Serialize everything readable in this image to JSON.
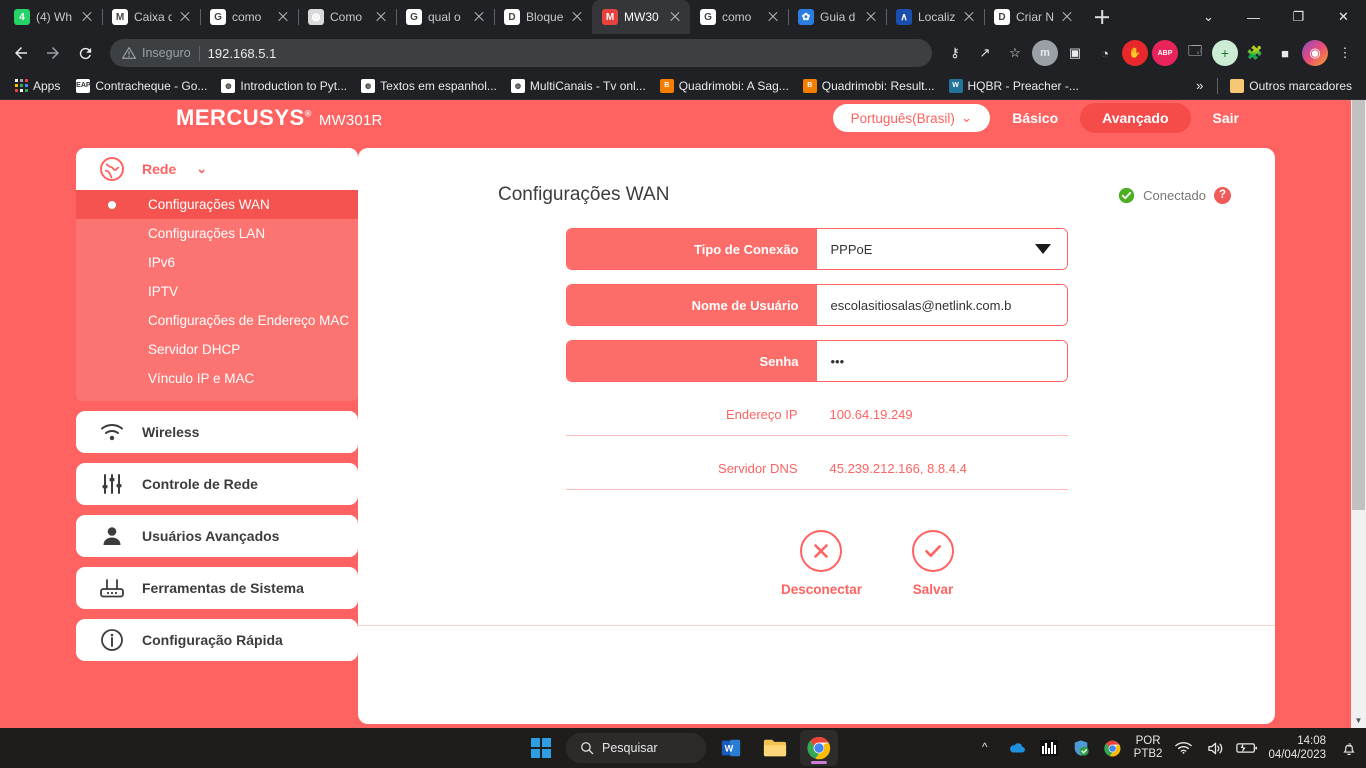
{
  "browser": {
    "tabs": [
      {
        "title": "(4) Wh",
        "favicon": "whatsapp-icon",
        "color": "#25d366",
        "glyph": "4",
        "active": false
      },
      {
        "title": "Caixa d",
        "favicon": "gmail-icon",
        "color": "#ffffff",
        "glyph": "M",
        "active": false
      },
      {
        "title": "como ",
        "favicon": "google-icon",
        "color": "#ffffff",
        "glyph": "G",
        "active": false
      },
      {
        "title": "Como ",
        "favicon": "globe-icon",
        "color": "#d9d9d9",
        "glyph": "◍",
        "active": false
      },
      {
        "title": "qual o",
        "favicon": "google-icon",
        "color": "#ffffff",
        "glyph": "G",
        "active": false
      },
      {
        "title": "Bloque",
        "favicon": "dell-icon",
        "color": "#ffffff",
        "glyph": "D",
        "active": false
      },
      {
        "title": "MW30",
        "favicon": "mercusys-icon",
        "color": "#e8413e",
        "glyph": "M",
        "active": true
      },
      {
        "title": "como ",
        "favicon": "google-icon",
        "color": "#ffffff",
        "glyph": "G",
        "active": false
      },
      {
        "title": "Guia d",
        "favicon": "flower-icon",
        "color": "#2a7de1",
        "glyph": "✿",
        "active": false
      },
      {
        "title": "Localiz",
        "favicon": "peak-icon",
        "color": "#1a4fb0",
        "glyph": "∧",
        "active": false
      },
      {
        "title": "Criar N",
        "favicon": "dell-icon",
        "color": "#ffffff",
        "glyph": "D",
        "active": false
      }
    ],
    "new_tab_label": "+",
    "window_controls": {
      "tab_search": "⌄",
      "minimize": "—",
      "maximize": "❐",
      "close": "✕"
    },
    "nav": {
      "back": "←",
      "forward": "→",
      "reload": "⟳"
    },
    "omnibox": {
      "warning_icon": "not-secure-icon",
      "warning_label": "Inseguro",
      "url": "192.168.5.1"
    },
    "toolbar_icons": [
      {
        "name": "password-key-icon",
        "glyph": "⚷"
      },
      {
        "name": "share-icon",
        "glyph": "↗"
      },
      {
        "name": "bookmark-star-icon",
        "glyph": "☆"
      },
      {
        "name": "mega-extension-icon",
        "glyph": "m"
      },
      {
        "name": "picture-in-picture-icon",
        "glyph": "▣"
      },
      {
        "name": "speedtest-extension-icon",
        "glyph": "◔"
      },
      {
        "name": "stop-extension-icon",
        "glyph": "✋"
      },
      {
        "name": "adblock-plus-icon",
        "glyph": "ABP"
      },
      {
        "name": "screenshot-extension-icon",
        "glyph": "🗔"
      },
      {
        "name": "add-extension-icon",
        "glyph": "+"
      },
      {
        "name": "extensions-puzzle-icon",
        "glyph": "🧩"
      },
      {
        "name": "square-extension-icon",
        "glyph": "■"
      },
      {
        "name": "profile-avatar-icon",
        "glyph": "◉"
      },
      {
        "name": "chrome-menu-icon",
        "glyph": "⋮"
      }
    ],
    "bookmarks": {
      "apps_label": "Apps",
      "items": [
        {
          "label": "Contracheque - Go...",
          "favicon": "eap6-icon",
          "color": "#ffffff",
          "glyph": "EAP"
        },
        {
          "label": "Introduction to Pyt...",
          "favicon": "globe-icon",
          "color": "#ffffff",
          "glyph": "◍"
        },
        {
          "label": "Textos em espanhol...",
          "favicon": "globe-icon",
          "color": "#ffffff",
          "glyph": "◍"
        },
        {
          "label": "MultiCanais - Tv onl...",
          "favicon": "globe-icon",
          "color": "#ffffff",
          "glyph": "◍"
        },
        {
          "label": "Quadrimobi: A Sag...",
          "favicon": "blogger-icon",
          "color": "#f57d00",
          "glyph": "B"
        },
        {
          "label": "Quadrimobi: Result...",
          "favicon": "blogger-icon",
          "color": "#f57d00",
          "glyph": "B"
        },
        {
          "label": "HQBR - Preacher -...",
          "favicon": "wordpress-icon",
          "color": "#21759b",
          "glyph": "W"
        }
      ],
      "overflow_label": "»",
      "other_bookmarks_label": "Outros marcadores"
    }
  },
  "router": {
    "brand": "MERCUSYS",
    "brand_trademark": "®",
    "model": "MW301R",
    "language": "Português(Brasil)",
    "language_caret": "⌄",
    "nav": {
      "basic": "Básico",
      "advanced": "Avançado",
      "logout": "Sair"
    },
    "sidebar": {
      "groups": [
        {
          "label": "Rede",
          "icon": "globe-network-icon",
          "caret": "⌄",
          "open": true,
          "items": [
            {
              "label": "Configurações WAN",
              "active": true
            },
            {
              "label": "Configurações LAN",
              "active": false
            },
            {
              "label": "IPv6",
              "active": false
            },
            {
              "label": "IPTV",
              "active": false
            },
            {
              "label": "Configurações de Endereço MAC",
              "active": false
            },
            {
              "label": "Servidor DHCP",
              "active": false
            },
            {
              "label": "Vínculo IP e MAC",
              "active": false
            }
          ]
        },
        {
          "label": "Wireless",
          "icon": "wifi-icon",
          "open": false,
          "items": []
        },
        {
          "label": "Controle de Rede",
          "icon": "sliders-icon",
          "open": false,
          "items": []
        },
        {
          "label": "Usuários Avançados",
          "icon": "user-icon",
          "open": false,
          "items": []
        },
        {
          "label": "Ferramentas de Sistema",
          "icon": "router-icon",
          "open": false,
          "items": []
        },
        {
          "label": "Configuração Rápida",
          "icon": "info-circle-icon",
          "open": false,
          "items": []
        }
      ]
    },
    "content": {
      "title": "Configurações WAN",
      "status": "Conectado",
      "status_icon": "check-circle-green-icon",
      "help_icon": "question-mark-icon",
      "fields": [
        {
          "label": "Tipo de Conexão",
          "value": "PPPoE",
          "type": "select"
        },
        {
          "label": "Nome de Usuário",
          "value": "escolasitiosalas@netlink.com.b",
          "type": "text"
        },
        {
          "label": "Senha",
          "value": "•••",
          "type": "password"
        }
      ],
      "info_rows": [
        {
          "label": "Endereço IP",
          "value": "100.64.19.249"
        },
        {
          "label": "Servidor DNS",
          "value": "45.239.212.166, 8.8.4.4"
        }
      ],
      "actions": [
        {
          "label": "Desconectar",
          "icon": "x-circle-icon"
        },
        {
          "label": "Salvar",
          "icon": "check-circle-icon"
        }
      ]
    },
    "accent": "#ff6361",
    "accent_dark": "#f54c4a"
  },
  "taskbar": {
    "start_label": "start-button",
    "search_placeholder": "Pesquisar",
    "apps": [
      {
        "name": "word-icon",
        "glyph": "W"
      },
      {
        "name": "file-explorer-icon",
        "glyph": "📁"
      },
      {
        "name": "chrome-icon",
        "glyph": "◉"
      }
    ],
    "tray": {
      "overflow": "^",
      "icons": [
        {
          "name": "onedrive-icon",
          "glyph": "☁"
        },
        {
          "name": "equalizer-icon",
          "glyph": "▮"
        },
        {
          "name": "windows-security-icon",
          "glyph": "🛡"
        },
        {
          "name": "chrome-tray-icon",
          "glyph": "◉"
        }
      ],
      "language_line1": "POR",
      "language_line2": "PTB2",
      "wifi_icon": "wifi-icon",
      "volume_icon": "volume-icon",
      "battery_icon": "battery-charging-icon",
      "time": "14:08",
      "date": "04/04/2023",
      "notifications_icon": "bell-dnd-icon"
    }
  }
}
